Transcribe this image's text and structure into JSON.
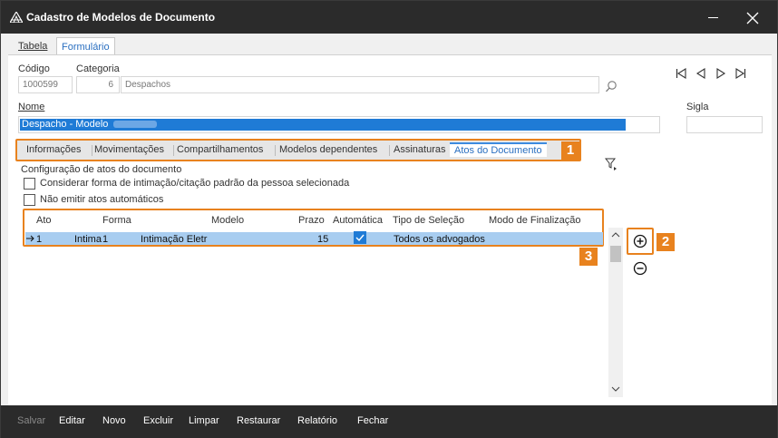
{
  "window": {
    "title": "Cadastro de Modelos de Documento"
  },
  "top_tabs": [
    {
      "label": "Tabela"
    },
    {
      "label": "Formulário"
    }
  ],
  "form": {
    "codigo_label": "Código",
    "codigo_value": "1000599",
    "categoria_label": "Categoria",
    "categoria_num": "6",
    "categoria_name": "Despachos",
    "nome_label": "Nome",
    "nome_value": "Despacho - Modelo",
    "sigla_label": "Sigla"
  },
  "inner_tabs": [
    {
      "label": "Informações"
    },
    {
      "label": "Movimentações"
    },
    {
      "label": "Compartilhamentos"
    },
    {
      "label": "Modelos dependentes"
    },
    {
      "label": "Assinaturas"
    },
    {
      "label": "Atos do Documento"
    }
  ],
  "badges": {
    "b1": "1",
    "b2": "2",
    "b3": "3"
  },
  "atos": {
    "section_label": "Configuração de atos do documento",
    "checkbox1": "Considerar forma de intimação/citação padrão da pessoa selecionada",
    "checkbox2": "Não emitir atos automáticos"
  },
  "grid": {
    "columns": [
      "Ato",
      "Forma",
      "Modelo",
      "Prazo",
      "Automática",
      "Tipo de Seleção",
      "Modo de Finalização"
    ],
    "rows": [
      {
        "ato": "1",
        "forma": "Intimação",
        "forma_num": "1",
        "modelo": "Intimação Eletr",
        "prazo": "15",
        "automatica": true,
        "tipo_selecao": "Todos os advogados",
        "modo_finalizacao": ""
      }
    ]
  },
  "bottom_buttons": [
    {
      "label": "Salvar",
      "enabled": false
    },
    {
      "label": "Editar",
      "enabled": true
    },
    {
      "label": "Novo",
      "enabled": true
    },
    {
      "label": "Excluir",
      "enabled": true
    },
    {
      "label": "Limpar",
      "enabled": true
    },
    {
      "label": "Restaurar",
      "enabled": true
    },
    {
      "label": "Relatório",
      "enabled": true
    },
    {
      "label": "Fechar",
      "enabled": true
    }
  ],
  "colors": {
    "accent": "#e8821e",
    "selection": "#1f7bd6",
    "titlebar": "#2b2b2b"
  }
}
